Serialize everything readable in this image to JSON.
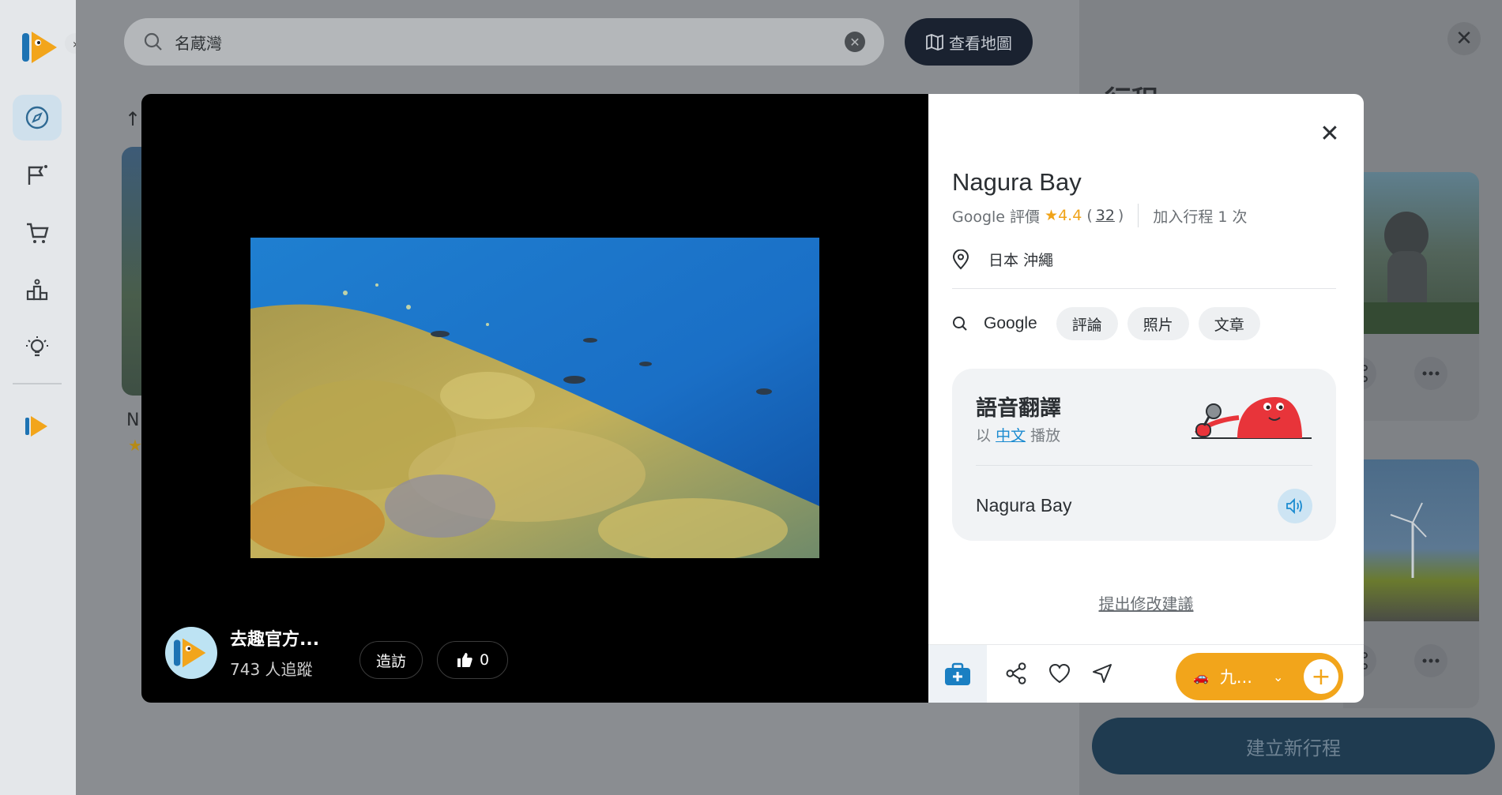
{
  "search": {
    "value": "名蔵灣",
    "map_button_label": "查看地圖"
  },
  "background": {
    "card_initial": "N",
    "card_star": "★",
    "right_panel_title": "行程",
    "new_trip_label": "建立新行程"
  },
  "media": {
    "author_name": "去趣官方...",
    "followers": "743 人追蹤",
    "visit_label": "造訪",
    "like_count": "0"
  },
  "place": {
    "name": "Nagura Bay",
    "rating_source": "Google 評價",
    "rating": "4.4",
    "review_count": "32",
    "added_to_trips": "加入行程 1 次",
    "location": "日本 沖繩"
  },
  "search_links": {
    "google": "Google",
    "chips": [
      "評論",
      "照片",
      "文章"
    ]
  },
  "translation": {
    "title": "語音翻譯",
    "prefix": "以",
    "language": "中文",
    "suffix": "播放",
    "phrase": "Nagura Bay"
  },
  "suggest_edit": "提出修改建議",
  "trip_selector": {
    "emoji": "🚗",
    "label": "九..."
  },
  "colors": {
    "accent": "#f2a51b",
    "link": "#1b8bd0",
    "brand_blue": "#1a7fc2"
  }
}
